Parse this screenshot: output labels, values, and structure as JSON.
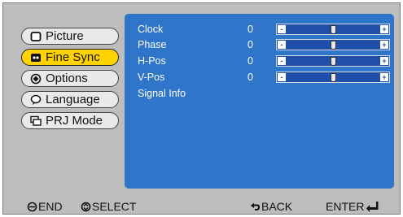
{
  "nav": [
    {
      "label": "Picture",
      "icon": "picture-icon",
      "active": false
    },
    {
      "label": "Fine Sync",
      "icon": "fine-sync-icon",
      "active": true
    },
    {
      "label": "Options",
      "icon": "options-icon",
      "active": false
    },
    {
      "label": "Language",
      "icon": "language-icon",
      "active": false
    },
    {
      "label": "PRJ Mode",
      "icon": "prj-mode-icon",
      "active": false
    }
  ],
  "settings": [
    {
      "label": "Clock",
      "value": "0",
      "level": 0.5
    },
    {
      "label": "Phase",
      "value": "0",
      "level": 0.5
    },
    {
      "label": "H-Pos",
      "value": "0",
      "level": 0.5
    },
    {
      "label": "V-Pos",
      "value": "0",
      "level": 0.5
    }
  ],
  "signal_info": "Signal Info",
  "slider": {
    "minus": "-",
    "plus": "+"
  },
  "footer": {
    "end": "END",
    "select": "SELECT",
    "back": "BACK",
    "enter": "ENTER"
  },
  "colors": {
    "panel": "#2f75c9",
    "active": "#ffd200",
    "bg": "#bdbdbd"
  }
}
